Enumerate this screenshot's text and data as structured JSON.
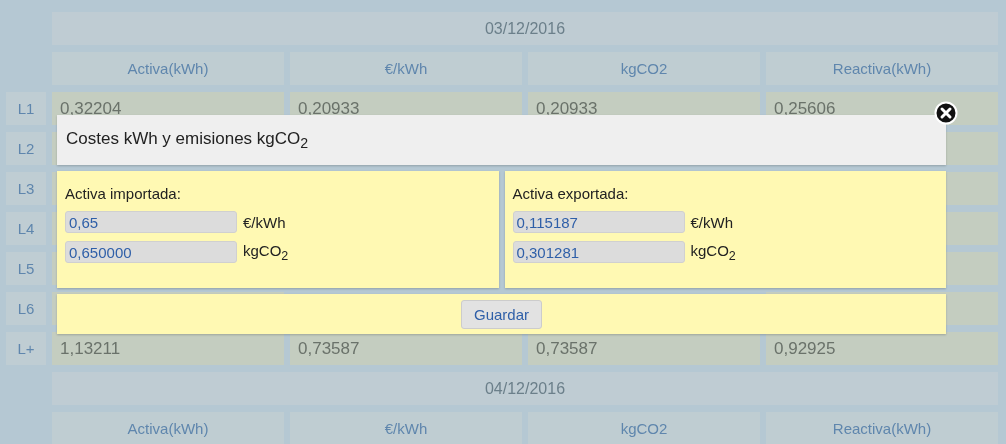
{
  "sections": [
    {
      "date": "03/12/2016",
      "columns": [
        "Activa(kWh)",
        "€/kWh",
        "kgCO2",
        "Reactiva(kWh)"
      ],
      "rows": [
        {
          "label": "L1",
          "values": [
            "0,32204",
            "0,20933",
            "0,20933",
            "0,25606"
          ]
        },
        {
          "label": "L2"
        },
        {
          "label": "L3"
        },
        {
          "label": "L4"
        },
        {
          "label": "L5"
        },
        {
          "label": "L6"
        },
        {
          "label": "L+",
          "values": [
            "1,13211",
            "0,73587",
            "0,73587",
            "0,92925"
          ]
        }
      ]
    },
    {
      "date": "04/12/2016",
      "columns": [
        "Activa(kWh)",
        "€/kWh",
        "kgCO2",
        "Reactiva(kWh)"
      ]
    }
  ],
  "dialog": {
    "title": "Costes kWh y emisiones kgCO$_{2}$",
    "panels": [
      {
        "title": "Activa importada:",
        "fields": [
          {
            "value": "0,65",
            "unit": "€/kWh"
          },
          {
            "value": "0,650000",
            "unit": "kgCO$_{2}$"
          }
        ]
      },
      {
        "title": "Activa exportada:",
        "fields": [
          {
            "value": "0,115187",
            "unit": "€/kWh"
          },
          {
            "value": "0,301281",
            "unit": "kgCO$_{2}$"
          }
        ]
      }
    ],
    "button": "Guardar"
  }
}
